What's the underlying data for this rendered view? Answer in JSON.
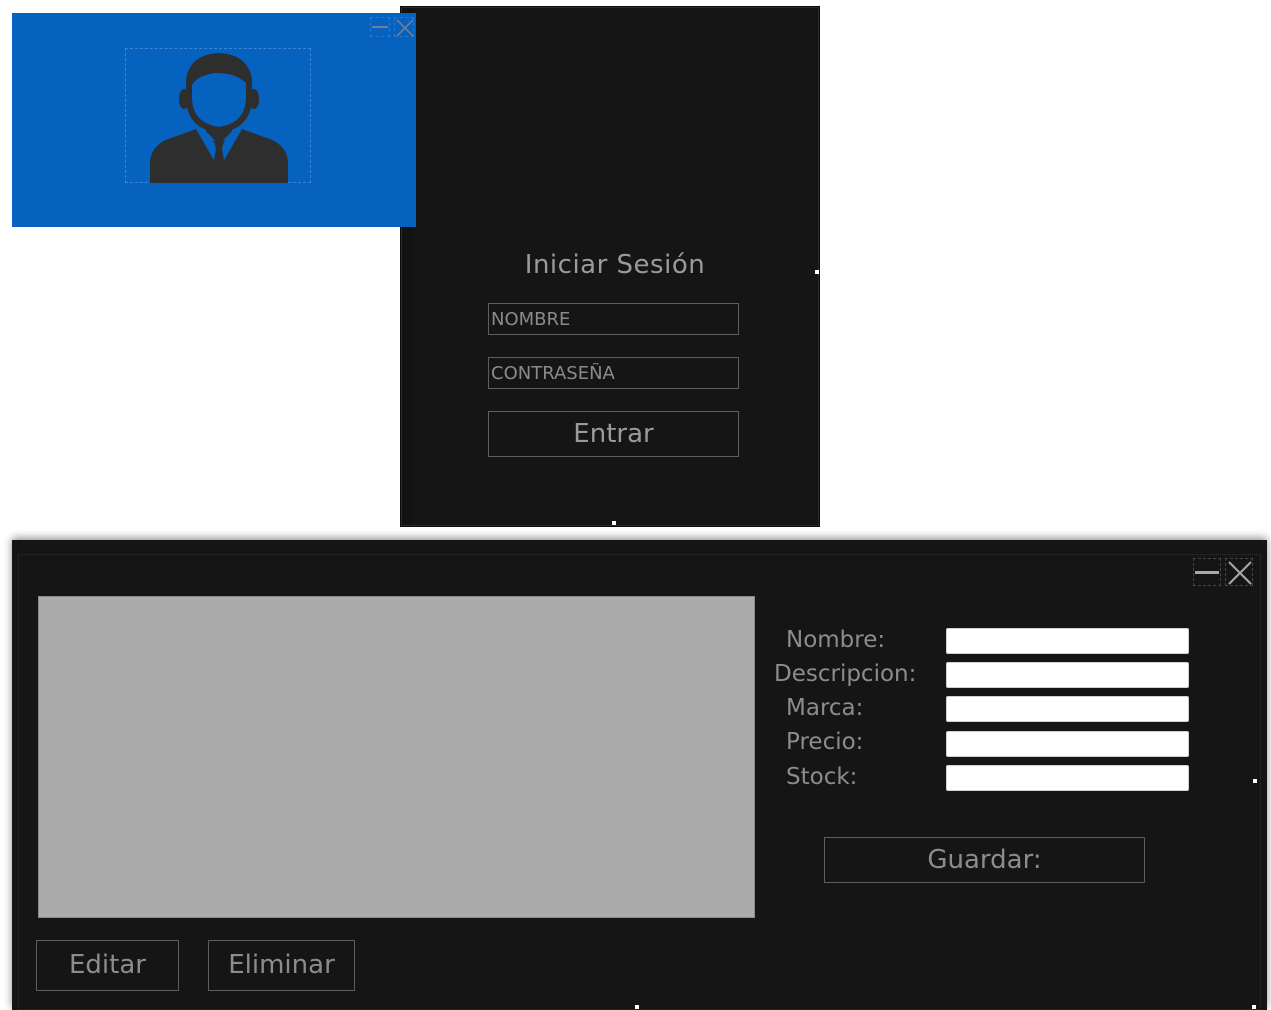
{
  "login": {
    "title": "Iniciar Sesión",
    "username_placeholder": "NOMBRE",
    "password_placeholder": "CONTRASEÑA",
    "submit_label": "Entrar",
    "header_color": "#0562bf",
    "avatar_icon": "user-avatar-icon"
  },
  "product_form": {
    "fields": [
      {
        "label": "Nombre:",
        "value": ""
      },
      {
        "label": "Descripcion:",
        "value": ""
      },
      {
        "label": "Marca:",
        "value": ""
      },
      {
        "label": "Precio:",
        "value": ""
      },
      {
        "label": "Stock:",
        "value": ""
      }
    ],
    "save_label": "Guardar:",
    "edit_label": "Editar",
    "delete_label": "Eliminar"
  },
  "window_controls": {
    "minimize_icon": "minimize-icon",
    "close_icon": "close-icon"
  },
  "colors": {
    "window_bg": "#151515",
    "grid_bg": "#ababab",
    "text": "#8c8c8c"
  }
}
